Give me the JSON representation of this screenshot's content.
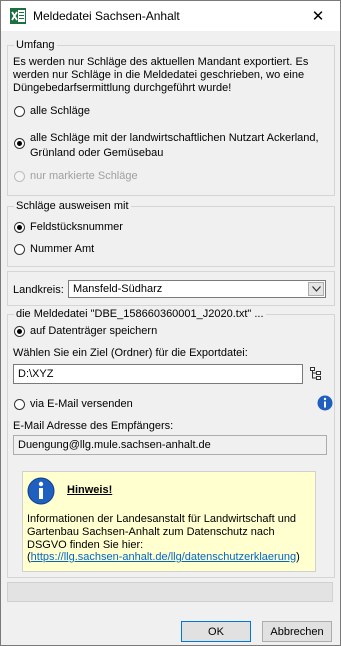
{
  "window": {
    "title": "Meldedatei Sachsen-Anhalt",
    "icon": "excel-icon",
    "close_icon": "close-icon"
  },
  "umfang": {
    "label": "Umfang",
    "description": "Es werden nur Schläge des aktuellen Mandant exportiert. Es werden nur Schläge in die Meldedatei geschrieben, wo eine Düngebedarfsermittlung durchgeführt wurde!",
    "options": [
      {
        "label": "alle Schläge",
        "checked": false,
        "disabled": false
      },
      {
        "label": "alle Schläge mit der landwirtschaftlichen Nutzart Ackerland, Grünland oder Gemüsebau",
        "checked": true,
        "disabled": false
      },
      {
        "label": "nur markierte Schläge",
        "checked": false,
        "disabled": true
      }
    ]
  },
  "ausweisen": {
    "label": "Schläge ausweisen mit",
    "options": [
      {
        "label": "Feldstücksnummer",
        "checked": true
      },
      {
        "label": "Nummer Amt",
        "checked": false
      }
    ]
  },
  "landkreis": {
    "label": "Landkreis:",
    "value": "Mansfeld-Südharz"
  },
  "export": {
    "label": "die Meldedatei \"DBE_158660360001_J2020.txt\" ...",
    "option_save": "auf Datenträger speichern",
    "choose_label": "Wählen Sie ein Ziel (Ordner) für die Exportdatei:",
    "path_value": "D:\\XYZ",
    "option_email": "via E-Mail versenden",
    "email_label": "E-Mail Adresse des Empfängers:",
    "email_value": "Duengung@llg.mule.sachsen-anhalt.de",
    "hint_title": "Hinweis!",
    "hint_text": "Informationen der Landesanstalt für Landwirtschaft und Gartenbau Sachsen-Anhalt zum Datenschutz nach DSGVO finden Sie hier:",
    "hint_link": "https://llg.sachsen-anhalt.de/llg/datenschutzerklaerung",
    "hint_link_open": "(",
    "hint_link_close": ")"
  },
  "buttons": {
    "ok": "OK",
    "cancel": "Abbrechen"
  }
}
